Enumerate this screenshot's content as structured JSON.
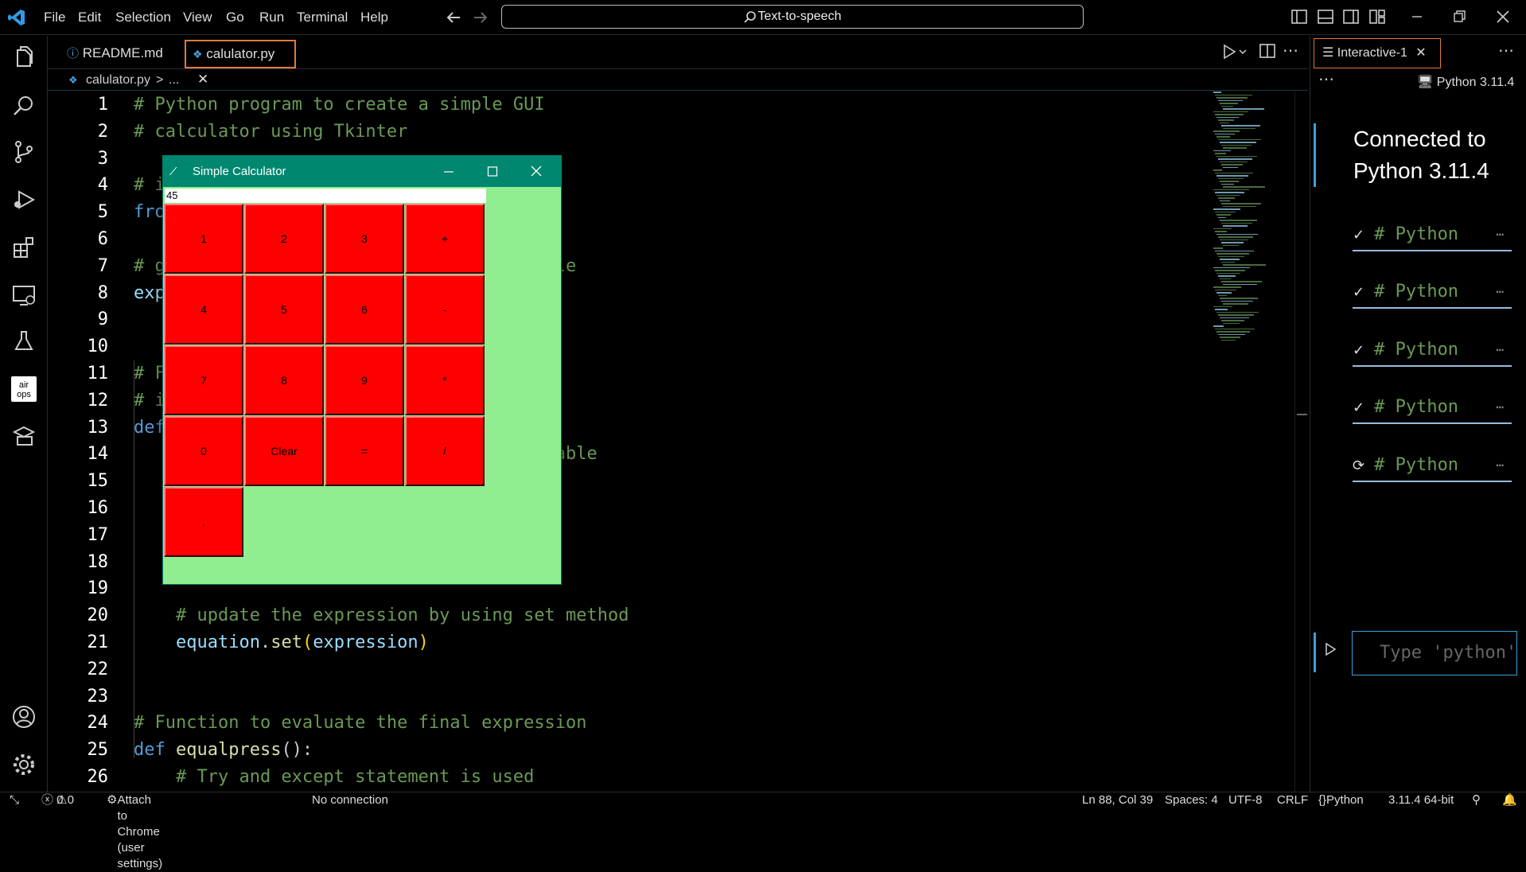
{
  "menu": [
    "File",
    "Edit",
    "Selection",
    "View",
    "Go",
    "Run",
    "Terminal",
    "Help"
  ],
  "search": {
    "label": "Text-to-speech"
  },
  "tabs": [
    {
      "label": "README.md"
    },
    {
      "label": "calulator.py"
    }
  ],
  "breadcrumb": {
    "file": "calulator.py",
    "sep": ">",
    "rest": "..."
  },
  "code": [
    {
      "n": "1",
      "t": "# Python program to create a simple GUI",
      "c": "com"
    },
    {
      "n": "2",
      "t": "# calculator using Tkinter",
      "c": "com"
    },
    {
      "n": "3",
      "t": "",
      "c": "pl"
    },
    {
      "n": "4",
      "t": "# i",
      "c": "com"
    },
    {
      "n": "5",
      "t": "fro",
      "c": "kw"
    },
    {
      "n": "6",
      "t": "",
      "c": "pl"
    },
    {
      "n": "7",
      "t": "# g                                    ble",
      "c": "com"
    },
    {
      "n": "8",
      "t": "exp",
      "c": "var"
    },
    {
      "n": "9",
      "t": "",
      "c": "pl"
    },
    {
      "n": "10",
      "t": "",
      "c": "pl"
    },
    {
      "n": "11",
      "t": "# F",
      "c": "com"
    },
    {
      "n": "12",
      "t": "# i",
      "c": "com"
    },
    {
      "n": "13",
      "t": "def",
      "c": "kw"
    },
    {
      "n": "14",
      "t": "                                     ariable",
      "c": "com"
    },
    {
      "n": "15",
      "t": "",
      "c": "pl"
    },
    {
      "n": "16",
      "t": "",
      "c": "pl"
    },
    {
      "n": "17",
      "t": "",
      "c": "pl"
    },
    {
      "n": "18",
      "t": "",
      "c": "pl"
    },
    {
      "n": "19",
      "t": "",
      "c": "pl"
    },
    {
      "n": "20",
      "t": "    # update the expression by using set method",
      "c": "com"
    },
    {
      "n": "21",
      "t": "",
      "c": "pl"
    },
    {
      "n": "22",
      "t": "",
      "c": "pl"
    },
    {
      "n": "23",
      "t": "",
      "c": "pl"
    },
    {
      "n": "24",
      "t": "# Function to evaluate the final expression",
      "c": "com"
    },
    {
      "n": "25",
      "t": "",
      "c": "pl"
    },
    {
      "n": "26",
      "t": "    # Try and except statement is used",
      "c": "com"
    }
  ],
  "line21": {
    "obj": "    equation",
    "dot": ".",
    "fn": "set",
    "open": "(",
    "arg": "expression",
    "close": ")"
  },
  "line25": {
    "kw": "def ",
    "fn": "equalpress",
    "p": "():"
  },
  "panel": {
    "tab": "Interactive-1",
    "kernel": "Python 3.11.4",
    "connected": "Connected to Python 3.11.4",
    "cells": [
      "# Python",
      "# Python",
      "# Python",
      "# Python",
      "# Python"
    ],
    "input_placeholder": "Type 'python'"
  },
  "calc": {
    "title": "Simple Calculator",
    "display": "45",
    "buttons": [
      "1",
      "2",
      "3",
      "+",
      "4",
      "5",
      "6",
      "-",
      "7",
      "8",
      "9",
      "*",
      "0",
      "Clear",
      "=",
      "/",
      "."
    ]
  },
  "status": {
    "errors": "0",
    "warnings": "0",
    "attach": "Attach to Chrome (user settings)",
    "conn": "No connection",
    "pos": "Ln 88, Col 39",
    "spaces": "Spaces: 4",
    "enc": "UTF-8",
    "eol": "CRLF",
    "lang": "Python",
    "interp": "3.11.4 64-bit"
  },
  "colors": {
    "calc_button": "#ff0000",
    "calc_bg": "#90ee90",
    "calc_title": "#00876f",
    "comment": "#6a9955",
    "keyword": "#569cd6"
  }
}
